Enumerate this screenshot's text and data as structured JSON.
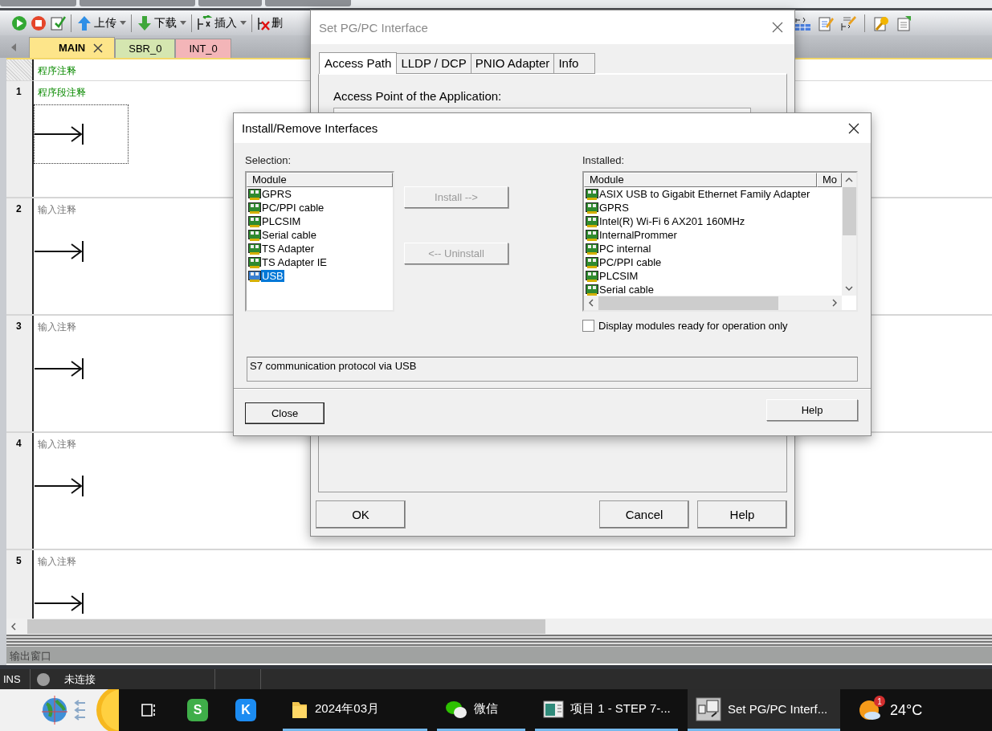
{
  "toolbar": {
    "items": [
      {
        "label": "上传",
        "dropdown": true
      },
      {
        "label": "下载",
        "dropdown": true
      },
      {
        "label": "插入",
        "dropdown": true
      },
      {
        "label": "删",
        "dropdown": false
      }
    ]
  },
  "editor_tabs": [
    {
      "label": "MAIN",
      "selected": true,
      "closable": true,
      "color": "#fde58a"
    },
    {
      "label": "SBR_0",
      "selected": false,
      "closable": false,
      "color": "#d5e6b0"
    },
    {
      "label": "INT_0",
      "selected": false,
      "closable": false,
      "color": "#f3b5b8"
    }
  ],
  "program_comment": "程序注释",
  "networks": [
    {
      "number": "1",
      "comment": "程序段注释",
      "selected": true
    },
    {
      "number": "2",
      "placeholder": "输入注释",
      "selected": false
    },
    {
      "number": "3",
      "placeholder": "输入注释",
      "selected": false
    },
    {
      "number": "4",
      "placeholder": "输入注释",
      "selected": false
    },
    {
      "number": "5",
      "placeholder": "输入注释",
      "selected": false
    }
  ],
  "output_window": {
    "title": "输出窗口"
  },
  "status_bar": {
    "mode": "INS",
    "connection": "未连接"
  },
  "pgpc_dialog": {
    "title": "Set PG/PC Interface",
    "active": false,
    "tabs": [
      {
        "label": "Access Path",
        "selected": true
      },
      {
        "label": "LLDP / DCP",
        "selected": false
      },
      {
        "label": "PNIO Adapter",
        "selected": false
      },
      {
        "label": "Info",
        "selected": false
      }
    ],
    "access_point_label": "Access Point of the Application:",
    "buttons": [
      "OK",
      "Cancel",
      "Help"
    ]
  },
  "install_dialog": {
    "title": "Install/Remove Interfaces",
    "active": true,
    "selection_label": "Selection:",
    "selection_list": {
      "columns": [
        "Module"
      ],
      "items": [
        {
          "label": "GPRS",
          "selected": false
        },
        {
          "label": "PC/PPI cable",
          "selected": false
        },
        {
          "label": "PLCSIM",
          "selected": false
        },
        {
          "label": "Serial cable",
          "selected": false
        },
        {
          "label": "TS Adapter",
          "selected": false
        },
        {
          "label": "TS Adapter IE",
          "selected": false
        },
        {
          "label": "USB",
          "selected": true
        }
      ]
    },
    "install_button": {
      "label": "Install -->",
      "disabled": true
    },
    "uninstall_button": {
      "label": "<-- Uninstall",
      "disabled": true
    },
    "installed_label": "Installed:",
    "installed_list": {
      "columns": [
        "Module",
        "Mo"
      ],
      "items": [
        {
          "label": "ASIX USB to Gigabit Ethernet Family Adapter"
        },
        {
          "label": "GPRS"
        },
        {
          "label": "Intel(R) Wi-Fi 6 AX201 160MHz"
        },
        {
          "label": "InternalPrommer"
        },
        {
          "label": "PC internal"
        },
        {
          "label": "PC/PPI cable"
        },
        {
          "label": "PLCSIM"
        },
        {
          "label": "Serial cable"
        }
      ]
    },
    "ready_only": {
      "label": "Display modules ready for operation only",
      "checked": false
    },
    "description": "S7 communication protocol via USB",
    "close_button": "Close",
    "help_button": "Help"
  },
  "taskbar": {
    "pinned": [
      {
        "kind": "task-view"
      },
      {
        "kind": "app",
        "glyph": "S",
        "color": "#3fae49"
      },
      {
        "kind": "app",
        "glyph": "K",
        "color": "#1c8cf2"
      }
    ],
    "items": [
      {
        "kind": "folder",
        "label": "2024年03月",
        "running": true,
        "active": false
      },
      {
        "kind": "chat",
        "label": "微信",
        "running": true,
        "active": false
      },
      {
        "kind": "window",
        "label": "项目 1 - STEP 7-...",
        "running": true,
        "active": false
      },
      {
        "kind": "network",
        "label": "Set PG/PC Interf...",
        "running": true,
        "active": true
      }
    ],
    "weather": {
      "temperature": "24°C",
      "badge": "1"
    }
  }
}
